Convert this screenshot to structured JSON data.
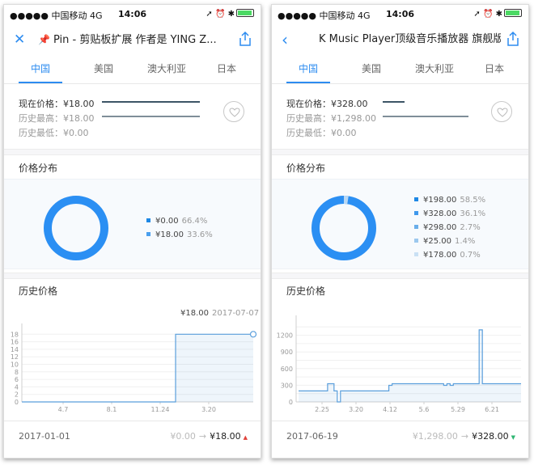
{
  "status_bar": {
    "carrier": "●●●●● 中国移动",
    "network": "4G",
    "time": "14:06"
  },
  "tabs": [
    "中国",
    "美国",
    "澳大利亚",
    "日本"
  ],
  "labels": {
    "current_price": "现在价格：",
    "history_high": "历史最高：",
    "history_low": "历史最低：",
    "price_distribution": "价格分布",
    "price_history": "历史价格"
  },
  "colors": {
    "accent": "#2d8cf0",
    "donut_main": "#2b8ff3",
    "donut_secondary": "#5ba8f0",
    "up_red": "#e0413a",
    "down_green": "#2fb672"
  },
  "left": {
    "title": "Pin - 剪贴板扩展 作者是 YING Z...",
    "nav_left_icon": "close-icon",
    "current_price": "¥18.00",
    "history_high": "¥18.00",
    "history_low": "¥0.00",
    "legend": [
      {
        "price": "¥0.00",
        "pct": "66.4%",
        "color": "#1e88e5"
      },
      {
        "price": "¥18.00",
        "pct": "33.6%",
        "color": "#4a9fee"
      }
    ],
    "tooltip": {
      "price": "¥18.00",
      "date": "2017-07-07"
    },
    "chart_data": {
      "type": "line",
      "x_ticks": [
        "4.7",
        "8.1",
        "11.24",
        "3.20"
      ],
      "ylim": [
        0,
        20
      ],
      "y_ticks": [
        0,
        2,
        4,
        6,
        8,
        10,
        12,
        14,
        16,
        18
      ],
      "series": [
        {
          "values": [
            0,
            0,
            0,
            18,
            18
          ]
        }
      ]
    },
    "footer": {
      "date": "2017-01-01",
      "old_price": "¥0.00",
      "arrow": "→",
      "new_price": "¥18.00",
      "trend": "▲"
    }
  },
  "right": {
    "title": "K Music Player顶级音乐播放器 旗舰版",
    "nav_left_icon": "chevron-left-icon",
    "current_price": "¥328.00",
    "history_high": "¥1,298.00",
    "history_low": "¥0.00",
    "legend": [
      {
        "price": "¥198.00",
        "pct": "58.5%",
        "color": "#1e88e5"
      },
      {
        "price": "¥328.00",
        "pct": "36.1%",
        "color": "#3f98ec"
      },
      {
        "price": "¥298.00",
        "pct": "2.7%",
        "color": "#6aaeea"
      },
      {
        "price": "¥25.00",
        "pct": "1.4%",
        "color": "#9cc8ee"
      },
      {
        "price": "¥178.00",
        "pct": "0.7%",
        "color": "#c9e0f4"
      }
    ],
    "chart_data": {
      "type": "line",
      "x_ticks": [
        "2.25",
        "3.20",
        "4.12",
        "5.6",
        "5.29",
        "6.21"
      ],
      "ylim": [
        0,
        1500
      ],
      "y_ticks": [
        0,
        150,
        300,
        450,
        600,
        750,
        900,
        1050,
        1200,
        1350
      ],
      "y_tick_labels": [
        "0",
        "",
        "300",
        "",
        "600",
        "",
        "900",
        "",
        "1200",
        ""
      ],
      "series": [
        {
          "values": [
            198,
            198,
            198,
            198,
            198,
            198,
            198,
            198,
            198,
            328,
            328,
            198,
            0,
            198,
            198,
            198,
            198,
            198,
            198,
            198,
            198,
            198,
            198,
            198,
            198,
            198,
            198,
            198,
            298,
            328,
            328,
            328,
            328,
            328,
            328,
            328,
            328,
            328,
            328,
            328,
            328,
            328,
            328,
            328,
            328,
            298,
            328,
            298,
            328,
            328,
            328,
            328,
            328,
            328,
            328,
            328,
            1298,
            328,
            328,
            328,
            328,
            328,
            328,
            328,
            328,
            328,
            328,
            328,
            328
          ]
        }
      ]
    },
    "footer": {
      "date": "2017-06-19",
      "old_price": "¥1,298.00",
      "arrow": "→",
      "new_price": "¥328.00",
      "trend": "▼"
    }
  }
}
